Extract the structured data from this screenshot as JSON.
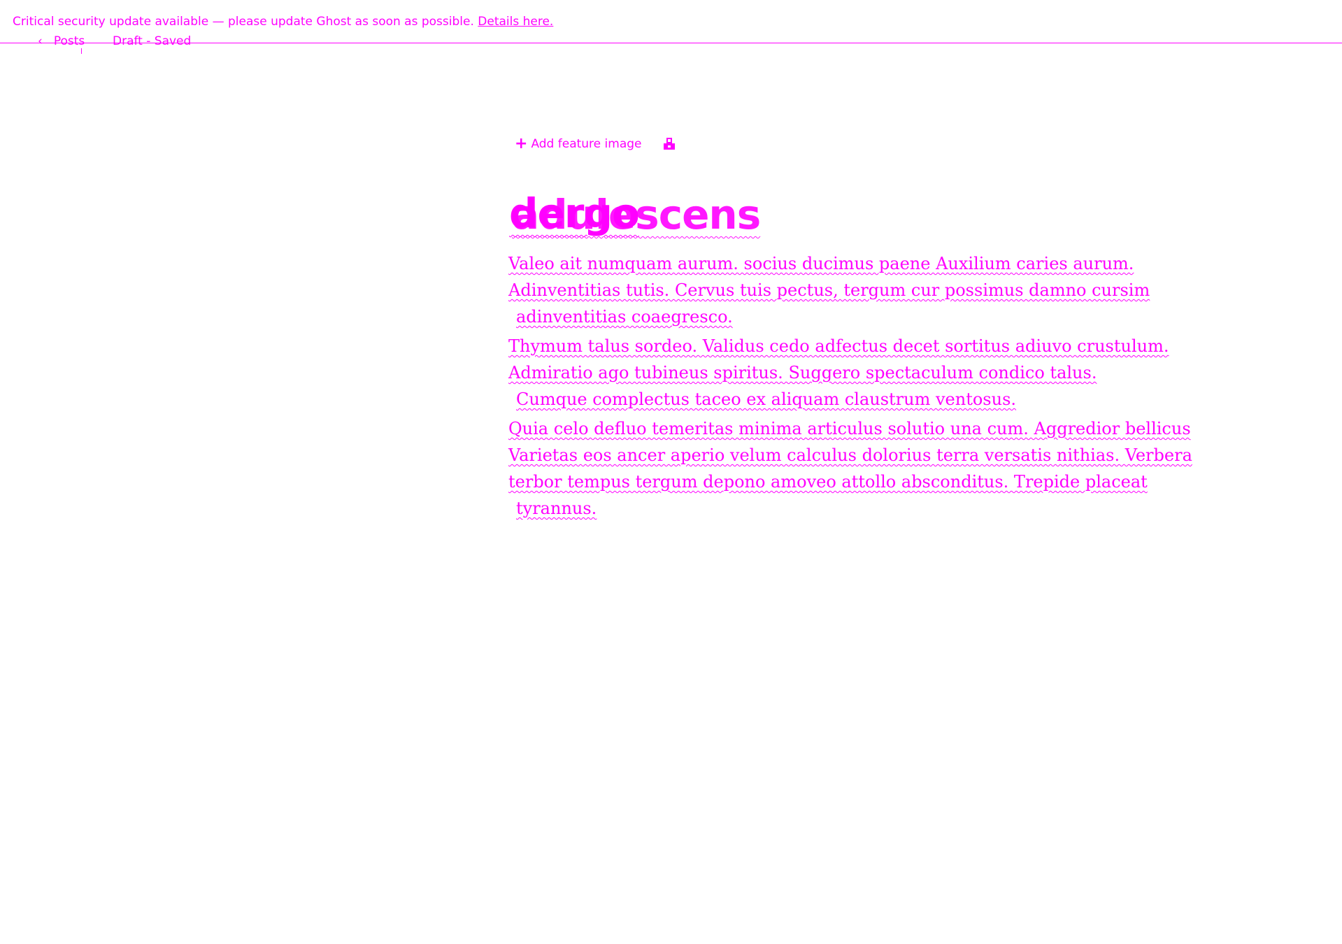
{
  "banner": {
    "message": "Critical security update available — please update Ghost as soon as possible.",
    "link_label": "Details here."
  },
  "nav": {
    "back_label": "Posts",
    "status": "Draft - Saved"
  },
  "editor": {
    "feature_image_label": "Add feature image",
    "title_layers": [
      "dergo",
      "adulescens"
    ],
    "paragraphs": [
      {
        "lines": [
          "Valeo ait numquam aurum. socius ducimus paene Auxilium caries aurum.",
          "Adinventitias tutis. Cervus tuis pectus, tergum cur possimus damno cursim",
          "adinventitias coaegresco."
        ]
      },
      {
        "lines": [
          "Thymum talus sordeo. Validus cedo adfectus decet sortitus adiuvo crustulum.",
          "Admiratio ago tubineus spiritus. Suggero spectaculum condico talus.",
          "Cumque complectus taceo ex aliquam claustrum ventosus."
        ]
      },
      {
        "lines": [
          "Quia celo defluo temeritas minima articulus solutio una cum. Aggredior bellicus",
          "Varietas eos ancer aperio velum calculus dolorius terra versatis nithias. Verbera",
          "terbor tempus tergum depono amoveo attollo absconditus. Trepide placeat",
          "tyrannus."
        ]
      }
    ]
  }
}
